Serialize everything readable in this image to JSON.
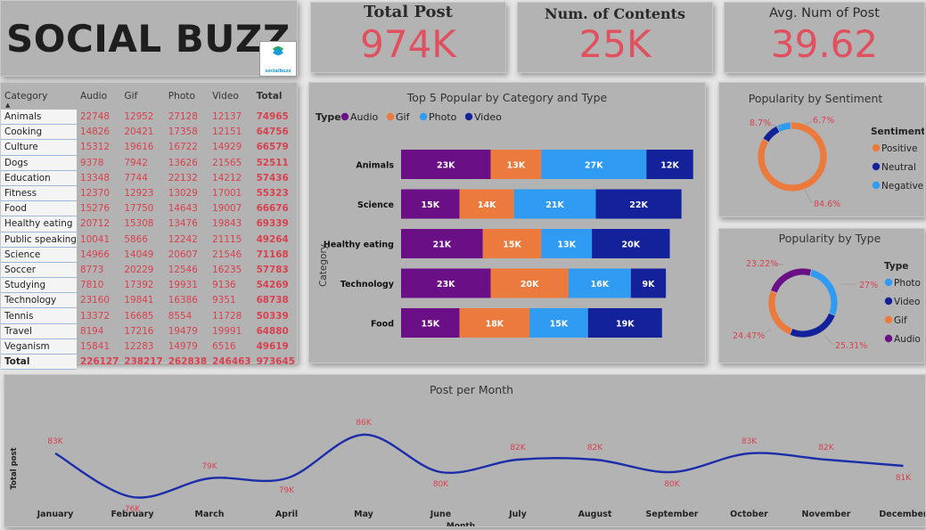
{
  "header": {
    "title": "SOCIAL BUZZ",
    "logo_text": "socialbuzz",
    "logo_icon": "social-buzz-logo"
  },
  "kpis": [
    {
      "label": "Total Post",
      "value": "974K"
    },
    {
      "label": "Num. of Contents",
      "value": "25K"
    },
    {
      "label": "Avg. Num of Post",
      "value": "39.62"
    }
  ],
  "matrix": {
    "headers": [
      "Category",
      "Audio",
      "Gif",
      "Photo",
      "Video",
      "Total"
    ],
    "rows": [
      [
        "Animals",
        "22748",
        "12952",
        "27128",
        "12137",
        "74965"
      ],
      [
        "Cooking",
        "14826",
        "20421",
        "17358",
        "12151",
        "64756"
      ],
      [
        "Culture",
        "15312",
        "19616",
        "16722",
        "14929",
        "66579"
      ],
      [
        "Dogs",
        "9378",
        "7942",
        "13626",
        "21565",
        "52511"
      ],
      [
        "Education",
        "13348",
        "7744",
        "22132",
        "14212",
        "57436"
      ],
      [
        "Fitness",
        "12370",
        "12923",
        "13029",
        "17001",
        "55323"
      ],
      [
        "Food",
        "15276",
        "17750",
        "14643",
        "19007",
        "66676"
      ],
      [
        "Healthy eating",
        "20712",
        "15308",
        "13476",
        "19843",
        "69339"
      ],
      [
        "Public speaking",
        "10041",
        "5866",
        "12242",
        "21115",
        "49264"
      ],
      [
        "Science",
        "14966",
        "14049",
        "20607",
        "21546",
        "71168"
      ],
      [
        "Soccer",
        "8773",
        "20229",
        "12546",
        "16235",
        "57783"
      ],
      [
        "Studying",
        "7810",
        "17392",
        "19931",
        "9136",
        "54269"
      ],
      [
        "Technology",
        "23160",
        "19841",
        "16386",
        "9351",
        "68738"
      ],
      [
        "Tennis",
        "13372",
        "16685",
        "8554",
        "11728",
        "50339"
      ],
      [
        "Travel",
        "8194",
        "17216",
        "19479",
        "19991",
        "64880"
      ],
      [
        "Veganism",
        "15841",
        "12283",
        "14979",
        "6516",
        "49619"
      ]
    ],
    "total": [
      "Total",
      "226127",
      "238217",
      "262838",
      "246463",
      "973645"
    ]
  },
  "top5": {
    "title": "Top 5 Popular by Category and Type",
    "legend_title": "Type",
    "ylabel": "Category",
    "colors": {
      "Audio": "#6a0f86",
      "Gif": "#ec7a3c",
      "Photo": "#2f9bf2",
      "Video": "#13219a"
    }
  },
  "sentiment": {
    "title": "Popularity by Sentiment",
    "legend_title": "Sentiment",
    "colors": {
      "Positive": "#ec7a3c",
      "Neutral": "#13219a",
      "Negative": "#2f9bf2"
    }
  },
  "type_donut": {
    "title": "Popularity by Type",
    "legend_title": "Type",
    "colors": {
      "Photo": "#2f9bf2",
      "Video": "#13219a",
      "Gif": "#ec7a3c",
      "Audio": "#6a0f86"
    }
  },
  "monthly": {
    "title": "Post per Month",
    "xlabel": "Month",
    "ylabel": "Total post",
    "line_color": "#1b2da8"
  },
  "chart_data": [
    {
      "type": "bar",
      "stacked": true,
      "orientation": "horizontal",
      "title": "Top 5 Popular by Category and Type",
      "ylabel": "Category",
      "categories": [
        "Animals",
        "Science",
        "Healthy eating",
        "Technology",
        "Food"
      ],
      "series": [
        {
          "name": "Audio",
          "values": [
            23,
            15,
            21,
            23,
            15
          ],
          "labels": [
            "23K",
            "15K",
            "21K",
            "23K",
            "15K"
          ]
        },
        {
          "name": "Gif",
          "values": [
            13,
            14,
            15,
            20,
            18
          ],
          "labels": [
            "13K",
            "14K",
            "15K",
            "20K",
            "18K"
          ]
        },
        {
          "name": "Photo",
          "values": [
            27,
            21,
            13,
            16,
            15
          ],
          "labels": [
            "27K",
            "21K",
            "13K",
            "16K",
            "15K"
          ]
        },
        {
          "name": "Video",
          "values": [
            12,
            22,
            20,
            9,
            19
          ],
          "labels": [
            "12K",
            "22K",
            "20K",
            "9K",
            "19K"
          ]
        }
      ],
      "legend": "top-left"
    },
    {
      "type": "pie",
      "donut": true,
      "title": "Popularity by Sentiment",
      "categories": [
        "Positive",
        "Neutral",
        "Negative"
      ],
      "values": [
        84.6,
        8.7,
        6.7
      ],
      "labels": [
        "84.6%",
        "8.7%",
        "6.7%"
      ],
      "legend": "right"
    },
    {
      "type": "pie",
      "donut": true,
      "title": "Popularity by Type",
      "categories": [
        "Photo",
        "Video",
        "Gif",
        "Audio"
      ],
      "values": [
        27,
        25.31,
        24.47,
        23.22
      ],
      "labels": [
        "27%",
        "25.31%",
        "24.47%",
        "23.22%"
      ],
      "legend": "right"
    },
    {
      "type": "line",
      "title": "Post per Month",
      "xlabel": "Month",
      "ylabel": "Total post",
      "x": [
        "January",
        "February",
        "March",
        "April",
        "May",
        "June",
        "July",
        "August",
        "September",
        "October",
        "November",
        "December"
      ],
      "values": [
        83,
        76,
        79,
        79,
        86,
        80,
        82,
        82,
        80,
        83,
        82,
        81
      ],
      "labels": [
        "83K",
        "76K",
        "79K",
        "79K",
        "86K",
        "80K",
        "82K",
        "82K",
        "80K",
        "83K",
        "82K",
        "81K"
      ],
      "grid": false
    }
  ]
}
